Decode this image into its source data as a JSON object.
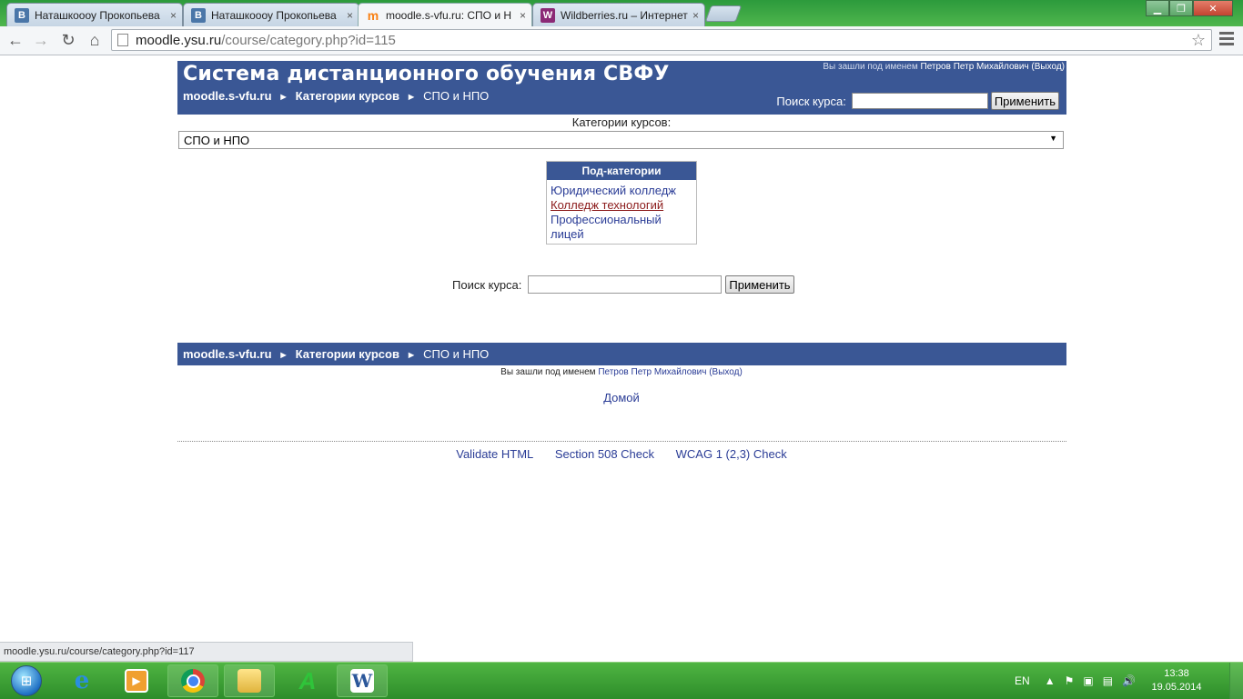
{
  "browser": {
    "tabs": [
      {
        "favicon": "В",
        "favicon_color": "#4a76a8",
        "title": "Наташкоооу Прокопьева",
        "active": false
      },
      {
        "favicon": "В",
        "favicon_color": "#4a76a8",
        "title": "Наташкоооу Прокопьева",
        "active": false
      },
      {
        "favicon": "m",
        "favicon_color": "#f98012",
        "title": "moodle.s-vfu.ru: СПО и Н",
        "active": true
      },
      {
        "favicon": "W",
        "favicon_color": "#8b2a76",
        "title": "Wildberries.ru – Интернет",
        "active": false
      }
    ],
    "close_glyph": "×",
    "url_host": "moodle.ysu.ru",
    "url_path": "/course/category.php?id=115",
    "status_url": "moodle.ysu.ru/course/category.php?id=117"
  },
  "header": {
    "site_title": "Система дистанционного обучения СВФУ",
    "login_prefix": "Вы зашли под именем",
    "login_user": "Петров Петр Михайлович",
    "logout": "(Выход)",
    "search_label": "Поиск курса:",
    "search_button": "Применить"
  },
  "breadcrumb": {
    "home": "moodle.s-vfu.ru",
    "separator": "►",
    "categories": "Категории курсов",
    "current": "СПО и НПО"
  },
  "category": {
    "label": "Категории курсов:",
    "selected": "СПО и НПО"
  },
  "subcategories": {
    "heading": "Под-категории",
    "items": [
      "Юридический колледж",
      "Колледж технологий",
      "Профессиональный лицей"
    ]
  },
  "search": {
    "label": "Поиск курса:",
    "button": "Применить"
  },
  "footer": {
    "login_prefix": "Вы зашли под именем",
    "login_user": "Петров Петр Михайлович",
    "logout": "(Выход)",
    "home_link": "Домой",
    "validators": [
      "Validate HTML",
      "Section 508 Check",
      "WCAG 1 (2,3) Check"
    ]
  },
  "taskbar": {
    "apps": [
      "internet-explorer",
      "media-player",
      "chrome",
      "file-explorer",
      "abbyy-lingvo",
      "microsoft-word"
    ],
    "app_labels": {
      "ie": "e",
      "word": "W",
      "lingvo": "A"
    },
    "lang": "EN",
    "time": "13:38",
    "date": "19.05.2014"
  },
  "colors": {
    "moodle_blue": "#3a5795",
    "link": "#2a3c96",
    "hover_link": "#8b1a1a",
    "taskbar_green": "#2d8d2a"
  }
}
